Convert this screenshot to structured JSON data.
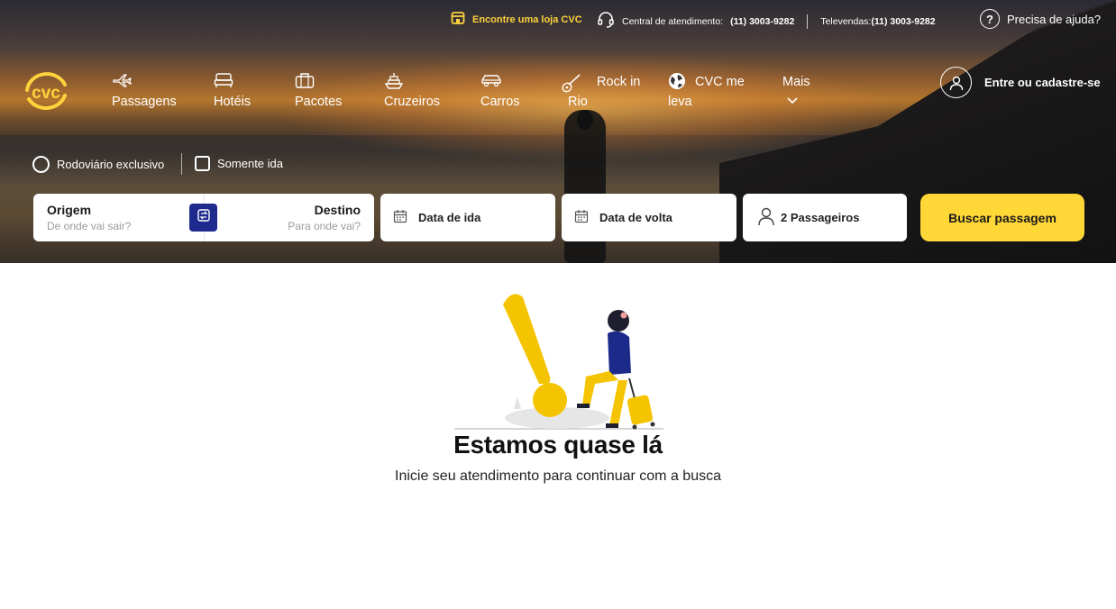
{
  "topbar": {
    "store_label": "Encontre uma loja CVC",
    "support_label": "Central de atendimento:",
    "support_phone": "(11) 3003-9282",
    "televendas_label": "Televendas:",
    "televendas_phone": "(11) 3003-9282",
    "help_label": "Precisa de ajuda?"
  },
  "brand": {
    "logo_text": "cvc",
    "accent": "#ffd737",
    "logo_ring": "#ffd33d",
    "swap_color": "#1e2a8e"
  },
  "nav": {
    "items": [
      {
        "label": "Passagens",
        "icon": "plane-icon"
      },
      {
        "label": "Hotéis",
        "icon": "bed-icon"
      },
      {
        "label": "Pacotes",
        "icon": "suitcase-icon"
      },
      {
        "label": "Cruzeiros",
        "icon": "ship-icon"
      },
      {
        "label": "Carros",
        "icon": "car-icon"
      },
      {
        "label_line1": "Rock in",
        "label_line2": "Rio",
        "icon": "guitar-icon"
      },
      {
        "label_line1": "CVC me",
        "label_line2": "leva",
        "icon": "globe-icon"
      },
      {
        "label": "Mais",
        "icon": "chevron-down-icon"
      }
    ],
    "account_label": "Entre ou cadastre-se"
  },
  "search": {
    "options": {
      "rodoviario": "Rodoviário exclusivo",
      "somente_ida": "Somente ida"
    },
    "origin_label": "Origem",
    "origin_placeholder": "De onde vai sair?",
    "destination_label": "Destino",
    "destination_placeholder": "Para onde vai?",
    "depart_label": "Data de ida",
    "return_label": "Data de volta",
    "passengers_label": "2 Passageiros",
    "search_button": "Buscar passagem"
  },
  "content": {
    "title": "Estamos quase lá",
    "subtitle": "Inicie seu atendimento para continuar com a busca"
  }
}
